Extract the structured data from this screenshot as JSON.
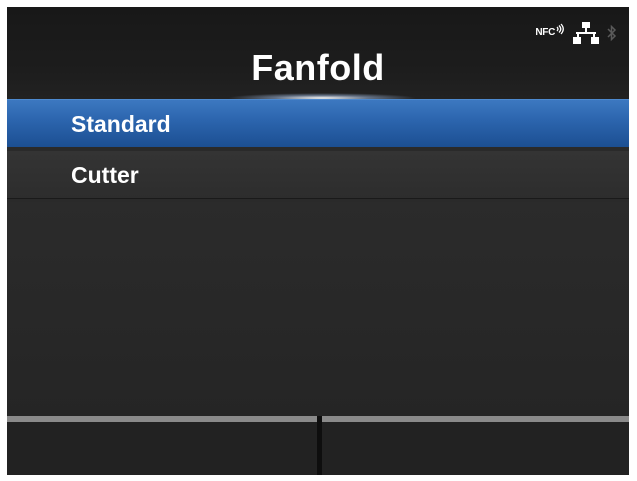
{
  "header": {
    "title": "Fanfold"
  },
  "status": {
    "nfc_label": "NFC",
    "icons": [
      "nfc-icon",
      "lan-icon",
      "bluetooth-icon"
    ]
  },
  "menu": {
    "items": [
      {
        "label": "Standard",
        "selected": true
      },
      {
        "label": "Cutter",
        "selected": false
      }
    ]
  },
  "softkeys": {
    "left_label": "",
    "right_label": ""
  },
  "colors": {
    "background": "#2a2a2a",
    "selected": "#2b64ad",
    "softkey_bar": "#8a8a8a"
  }
}
